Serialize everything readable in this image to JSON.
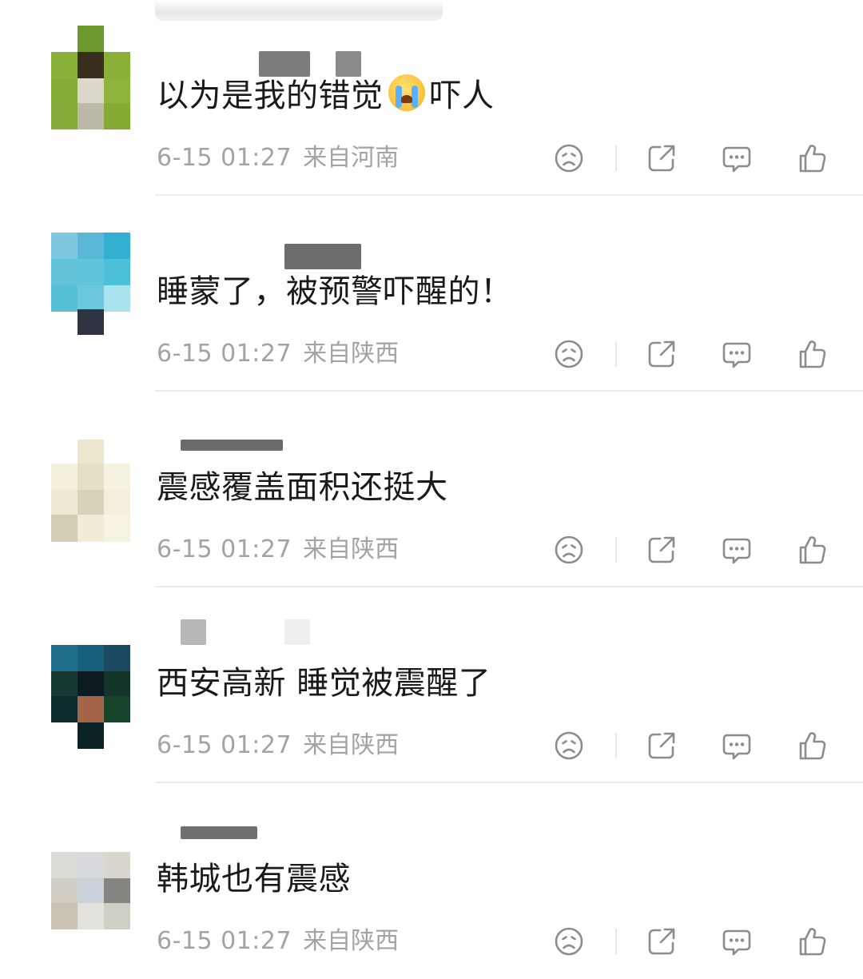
{
  "comments": [
    {
      "text_before": "以为是我的错觉",
      "emoji": "crying-face-emoji",
      "text_after": "吓人",
      "time": "6-15 01:27",
      "location": "来自河南"
    },
    {
      "text_before": "睡蒙了，被预警吓醒的！",
      "text_after": "",
      "time": "6-15 01:27",
      "location": "来自陕西"
    },
    {
      "text_before": "震感覆盖面积还挺大",
      "text_after": "",
      "time": "6-15 01:27",
      "location": "来自陕西"
    },
    {
      "text_before": "西安高新 睡觉被震醒了",
      "text_after": "",
      "time": "6-15 01:27",
      "location": "来自陕西"
    },
    {
      "text_before": "韩城也有震感",
      "text_after": "",
      "time": "6-15 01:27",
      "location": "来自陕西"
    }
  ],
  "icons": {
    "dislike": "sad-face-icon",
    "share": "share-icon",
    "comment": "comment-bubble-icon",
    "like": "thumbs-up-icon"
  },
  "colors": {
    "text": "#1a1a1a",
    "meta": "#a3a3a3",
    "icon": "#8c8c8c",
    "divider": "#ececec"
  }
}
